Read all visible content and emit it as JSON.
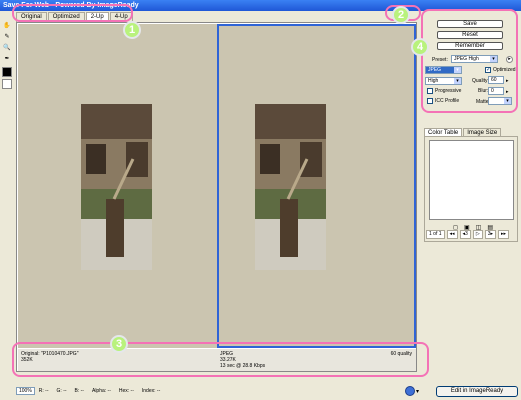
{
  "window": {
    "title": "Save For Web - Powered By ImageReady"
  },
  "tabs": [
    "Original",
    "Optimized",
    "2-Up",
    "4-Up"
  ],
  "annotations": [
    "1",
    "2",
    "3",
    "4"
  ],
  "panes": {
    "left": {
      "line1": "Original: \"P1010470.JPG\"",
      "line2": "352K"
    },
    "right": {
      "line1": "JPEG",
      "line2": "33.27K",
      "line3": "13 sec @ 28.8 Kbps",
      "quality": "60 quality"
    }
  },
  "status": {
    "zoom": "100%",
    "r": "R: --",
    "g": "G: --",
    "b": "B: --",
    "alpha": "Alpha: --",
    "hex": "Hex: --",
    "index": "Index: --"
  },
  "buttons": {
    "save": "Save",
    "reset": "Reset",
    "remember": "Remember",
    "edit": "Edit in ImageReady"
  },
  "settings": {
    "preset_label": "Preset:",
    "preset_value": "JPEG High",
    "format": "JPEG",
    "compression": "High",
    "optimized_label": "Optimized",
    "quality_label": "Quality:",
    "quality_value": "60",
    "progressive_label": "Progressive",
    "blur_label": "Blur:",
    "blur_value": "0",
    "icc_label": "ICC Profile",
    "matte_label": "Matte:"
  },
  "color_table": {
    "tab1": "Color Table",
    "tab2": "Image Size",
    "nav": [
      "1 of 1",
      "◂◂",
      "◂3",
      "▷",
      "3▸",
      "▸▸"
    ]
  }
}
